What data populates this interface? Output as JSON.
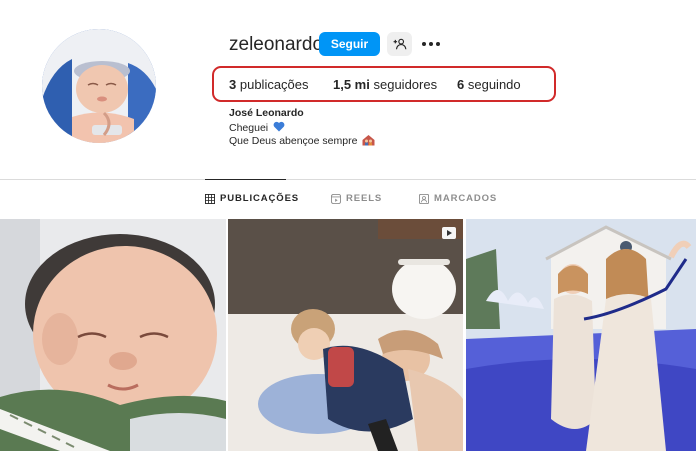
{
  "profile": {
    "username": "zeleonardo",
    "follow_label": "Seguir",
    "avatar_alt": "newborn-baby-avatar"
  },
  "stats": {
    "posts_count": "3",
    "posts_label": "publicações",
    "followers_count": "1,5 mi",
    "followers_label": "seguidores",
    "following_count": "6",
    "following_label": "seguindo"
  },
  "bio": {
    "name": "José Leonardo",
    "line1": "Cheguei",
    "line2": "Que Deus abençoe sempre"
  },
  "tabs": [
    {
      "label": "PUBLICAÇÕES",
      "icon": "grid-icon",
      "active": true
    },
    {
      "label": "REELS",
      "icon": "reels-icon",
      "active": false
    },
    {
      "label": "MARCADOS",
      "icon": "tagged-icon",
      "active": false
    }
  ],
  "posts": [
    {
      "type": "photo",
      "subject": "sleeping-newborn"
    },
    {
      "type": "reel",
      "subject": "mother-and-child-playing"
    },
    {
      "type": "photo",
      "subject": "mother-and-daughter-outdoors"
    }
  ],
  "colors": {
    "accent": "#0095f6",
    "highlight": "#d12a2a",
    "text": "#262626",
    "muted": "#8e8e8e",
    "divider": "#dbdbdb",
    "heart": "#3b7dd8"
  }
}
